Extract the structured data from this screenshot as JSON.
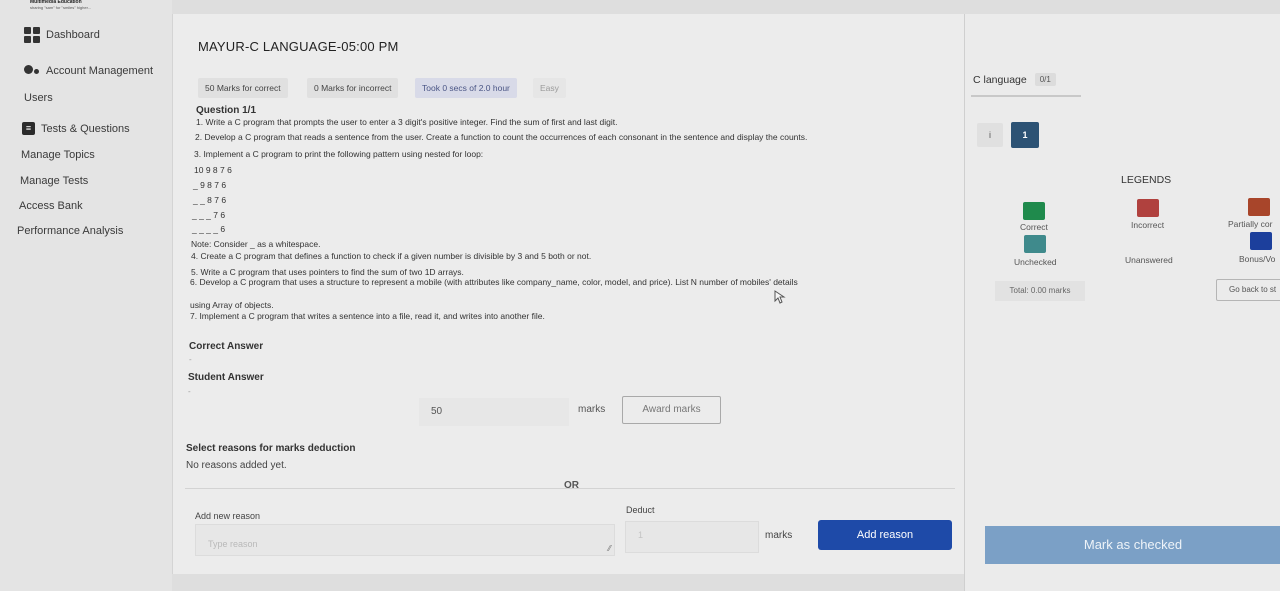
{
  "logo": {
    "line1": "Multimedia Education",
    "line2": "sharing \"sam\" for \"smiles\" higher..."
  },
  "sidebar": {
    "items": [
      {
        "label": "Dashboard",
        "icon": "dashboard-icon"
      },
      {
        "label": "Account Management",
        "icon": "account-icon"
      },
      {
        "label": "Users"
      },
      {
        "label": "Tests & Questions",
        "icon": "tests-icon"
      },
      {
        "label": "Manage Topics"
      },
      {
        "label": "Manage Tests"
      },
      {
        "label": "Access Bank"
      },
      {
        "label": "Performance Analysis"
      }
    ]
  },
  "main": {
    "title": "MAYUR-C LANGUAGE-05:00 PM",
    "chips": [
      "50 Marks for correct",
      "0 Marks for incorrect",
      "Took 0 secs of 2.0 hour",
      "Easy"
    ],
    "question_label": "Question 1/1",
    "question_lines": [
      "1. Write a C program that prompts the user to enter a 3 digit's positive integer. Find the sum of first and last digit.",
      "2. Develop a C program that reads a sentence from the user. Create a function to count the occurrences of each consonant in the sentence and display the counts.",
      "3. Implement a C program to print the following pattern using nested for loop:",
      "10 9 8 7 6",
      "_ 9 8 7 6",
      "_ _ 8 7 6",
      "_ _ _ 7 6",
      "_ _ _ _ 6",
      "Note: Consider _ as a whitespace.",
      "4. Create a C program that defines a function to check if a given number is divisible by 3 and 5 both or not.",
      "5. Write a C program that uses pointers to find the sum of two 1D arrays.",
      "6. Develop a C program that uses a structure to represent a mobile (with attributes like company_name, color, model, and price). List N number of mobiles' details",
      "using Array of objects.",
      "7. Implement a C program that writes a sentence into a file, read it, and writes into another file."
    ],
    "correct_answer_label": "Correct Answer",
    "correct_answer_value": "-",
    "student_answer_label": "Student Answer",
    "student_answer_value": "-",
    "marks_value": "50",
    "marks_label": "marks",
    "award_button": "Award marks",
    "reasons_heading": "Select reasons for marks deduction",
    "reasons_empty": "No reasons added yet.",
    "or_label": "OR",
    "add_new_reason_label": "Add new reason",
    "reason_placeholder": "Type reason",
    "deduct_label": "Deduct",
    "deduct_placeholder": "1",
    "deduct_marks_label": "marks",
    "add_reason_button": "Add reason"
  },
  "right": {
    "language_tab": "C language",
    "language_count": "0/1",
    "info_label": "i",
    "question_number": "1",
    "legends_title": "LEGENDS",
    "legends": [
      {
        "label": "Correct",
        "color": "#1f8a4c"
      },
      {
        "label": "Incorrect",
        "color": "#b0413e"
      },
      {
        "label": "Partially cor",
        "color": "#a8452a"
      },
      {
        "label": "Unchecked",
        "color": "#3f8a8c"
      },
      {
        "label": "Unanswered"
      },
      {
        "label": "Bonus/Vo",
        "color": "#1c3f9c"
      }
    ],
    "total": "Total: 0.00 marks",
    "go_back": "Go back to st",
    "mark_checked": "Mark as checked"
  }
}
